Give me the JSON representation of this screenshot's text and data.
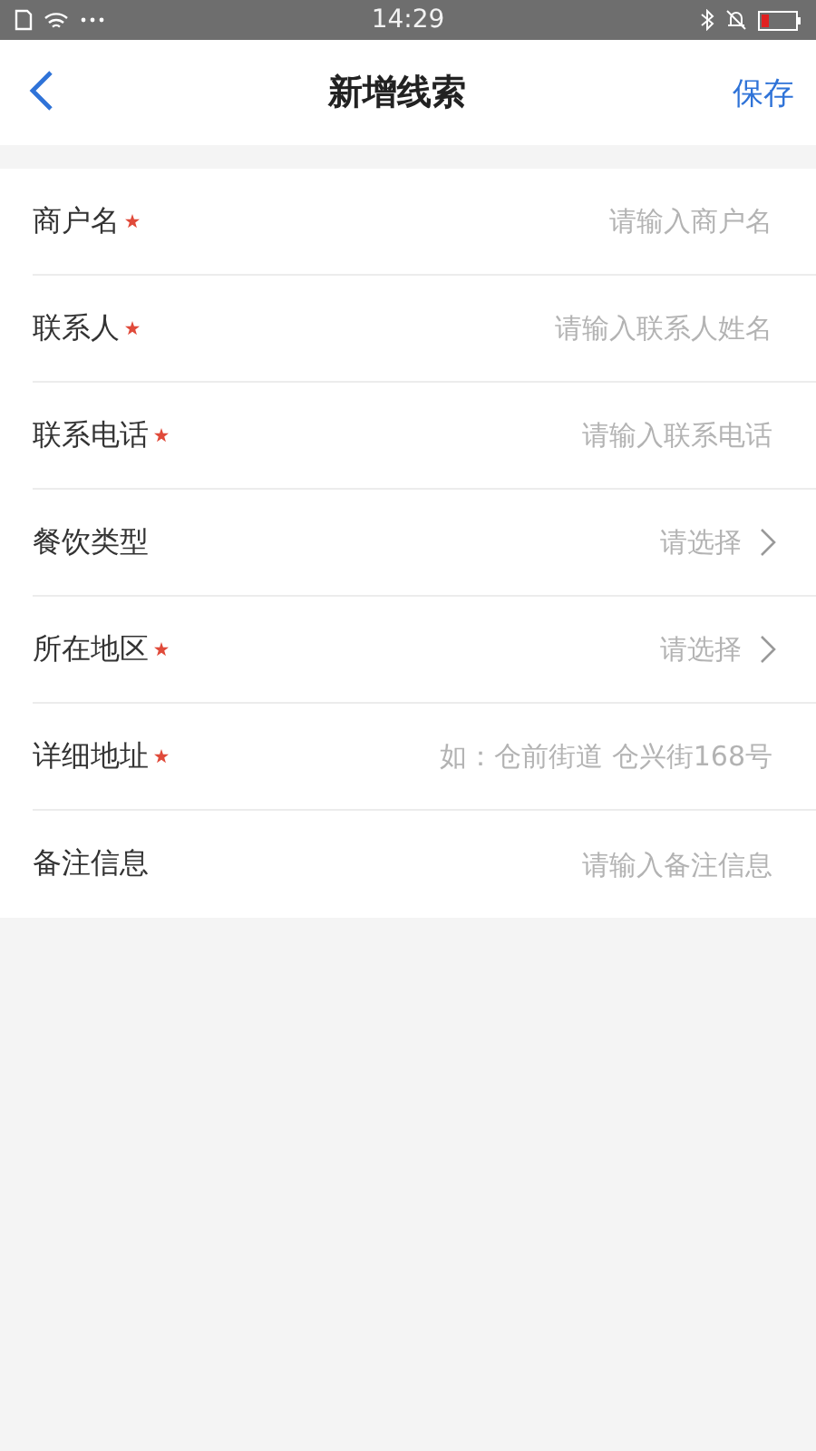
{
  "status_bar": {
    "time": "14:29"
  },
  "nav": {
    "title": "新增线索",
    "action": "保存"
  },
  "fields": [
    {
      "label": "商户名",
      "required": true,
      "kind": "input",
      "placeholder": "请输入商户名"
    },
    {
      "label": "联系人",
      "required": true,
      "kind": "input",
      "placeholder": "请输入联系人姓名"
    },
    {
      "label": "联系电话",
      "required": true,
      "kind": "input",
      "placeholder": "请输入联系电话"
    },
    {
      "label": "餐饮类型",
      "required": false,
      "kind": "select",
      "placeholder": "请选择"
    },
    {
      "label": "所在地区",
      "required": true,
      "kind": "select",
      "placeholder": "请选择"
    },
    {
      "label": "详细地址",
      "required": true,
      "kind": "input",
      "placeholder": "如：仓前街道 仓兴街168号"
    },
    {
      "label": "备注信息",
      "required": false,
      "kind": "input",
      "placeholder": "请输入备注信息"
    }
  ]
}
